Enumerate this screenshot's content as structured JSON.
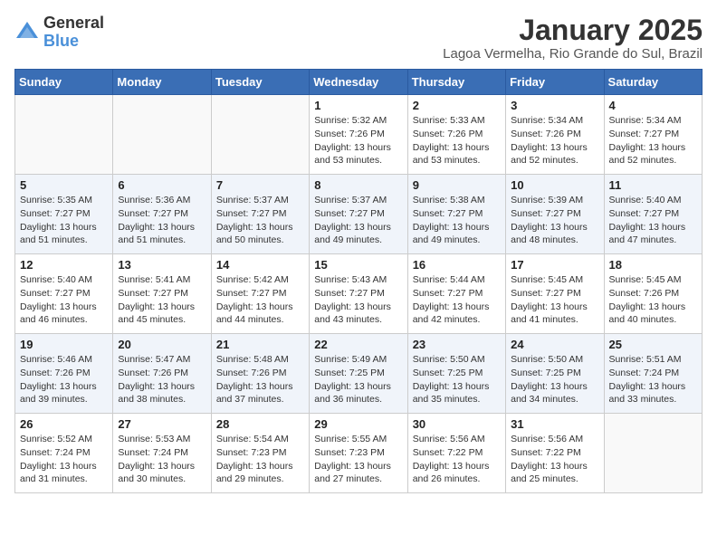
{
  "header": {
    "logo_general": "General",
    "logo_blue": "Blue",
    "month_title": "January 2025",
    "location": "Lagoa Vermelha, Rio Grande do Sul, Brazil"
  },
  "weekdays": [
    "Sunday",
    "Monday",
    "Tuesday",
    "Wednesday",
    "Thursday",
    "Friday",
    "Saturday"
  ],
  "weeks": [
    [
      {
        "day": "",
        "sunrise": "",
        "sunset": "",
        "daylight": ""
      },
      {
        "day": "",
        "sunrise": "",
        "sunset": "",
        "daylight": ""
      },
      {
        "day": "",
        "sunrise": "",
        "sunset": "",
        "daylight": ""
      },
      {
        "day": "1",
        "sunrise": "Sunrise: 5:32 AM",
        "sunset": "Sunset: 7:26 PM",
        "daylight": "Daylight: 13 hours and 53 minutes."
      },
      {
        "day": "2",
        "sunrise": "Sunrise: 5:33 AM",
        "sunset": "Sunset: 7:26 PM",
        "daylight": "Daylight: 13 hours and 53 minutes."
      },
      {
        "day": "3",
        "sunrise": "Sunrise: 5:34 AM",
        "sunset": "Sunset: 7:26 PM",
        "daylight": "Daylight: 13 hours and 52 minutes."
      },
      {
        "day": "4",
        "sunrise": "Sunrise: 5:34 AM",
        "sunset": "Sunset: 7:27 PM",
        "daylight": "Daylight: 13 hours and 52 minutes."
      }
    ],
    [
      {
        "day": "5",
        "sunrise": "Sunrise: 5:35 AM",
        "sunset": "Sunset: 7:27 PM",
        "daylight": "Daylight: 13 hours and 51 minutes."
      },
      {
        "day": "6",
        "sunrise": "Sunrise: 5:36 AM",
        "sunset": "Sunset: 7:27 PM",
        "daylight": "Daylight: 13 hours and 51 minutes."
      },
      {
        "day": "7",
        "sunrise": "Sunrise: 5:37 AM",
        "sunset": "Sunset: 7:27 PM",
        "daylight": "Daylight: 13 hours and 50 minutes."
      },
      {
        "day": "8",
        "sunrise": "Sunrise: 5:37 AM",
        "sunset": "Sunset: 7:27 PM",
        "daylight": "Daylight: 13 hours and 49 minutes."
      },
      {
        "day": "9",
        "sunrise": "Sunrise: 5:38 AM",
        "sunset": "Sunset: 7:27 PM",
        "daylight": "Daylight: 13 hours and 49 minutes."
      },
      {
        "day": "10",
        "sunrise": "Sunrise: 5:39 AM",
        "sunset": "Sunset: 7:27 PM",
        "daylight": "Daylight: 13 hours and 48 minutes."
      },
      {
        "day": "11",
        "sunrise": "Sunrise: 5:40 AM",
        "sunset": "Sunset: 7:27 PM",
        "daylight": "Daylight: 13 hours and 47 minutes."
      }
    ],
    [
      {
        "day": "12",
        "sunrise": "Sunrise: 5:40 AM",
        "sunset": "Sunset: 7:27 PM",
        "daylight": "Daylight: 13 hours and 46 minutes."
      },
      {
        "day": "13",
        "sunrise": "Sunrise: 5:41 AM",
        "sunset": "Sunset: 7:27 PM",
        "daylight": "Daylight: 13 hours and 45 minutes."
      },
      {
        "day": "14",
        "sunrise": "Sunrise: 5:42 AM",
        "sunset": "Sunset: 7:27 PM",
        "daylight": "Daylight: 13 hours and 44 minutes."
      },
      {
        "day": "15",
        "sunrise": "Sunrise: 5:43 AM",
        "sunset": "Sunset: 7:27 PM",
        "daylight": "Daylight: 13 hours and 43 minutes."
      },
      {
        "day": "16",
        "sunrise": "Sunrise: 5:44 AM",
        "sunset": "Sunset: 7:27 PM",
        "daylight": "Daylight: 13 hours and 42 minutes."
      },
      {
        "day": "17",
        "sunrise": "Sunrise: 5:45 AM",
        "sunset": "Sunset: 7:27 PM",
        "daylight": "Daylight: 13 hours and 41 minutes."
      },
      {
        "day": "18",
        "sunrise": "Sunrise: 5:45 AM",
        "sunset": "Sunset: 7:26 PM",
        "daylight": "Daylight: 13 hours and 40 minutes."
      }
    ],
    [
      {
        "day": "19",
        "sunrise": "Sunrise: 5:46 AM",
        "sunset": "Sunset: 7:26 PM",
        "daylight": "Daylight: 13 hours and 39 minutes."
      },
      {
        "day": "20",
        "sunrise": "Sunrise: 5:47 AM",
        "sunset": "Sunset: 7:26 PM",
        "daylight": "Daylight: 13 hours and 38 minutes."
      },
      {
        "day": "21",
        "sunrise": "Sunrise: 5:48 AM",
        "sunset": "Sunset: 7:26 PM",
        "daylight": "Daylight: 13 hours and 37 minutes."
      },
      {
        "day": "22",
        "sunrise": "Sunrise: 5:49 AM",
        "sunset": "Sunset: 7:25 PM",
        "daylight": "Daylight: 13 hours and 36 minutes."
      },
      {
        "day": "23",
        "sunrise": "Sunrise: 5:50 AM",
        "sunset": "Sunset: 7:25 PM",
        "daylight": "Daylight: 13 hours and 35 minutes."
      },
      {
        "day": "24",
        "sunrise": "Sunrise: 5:50 AM",
        "sunset": "Sunset: 7:25 PM",
        "daylight": "Daylight: 13 hours and 34 minutes."
      },
      {
        "day": "25",
        "sunrise": "Sunrise: 5:51 AM",
        "sunset": "Sunset: 7:24 PM",
        "daylight": "Daylight: 13 hours and 33 minutes."
      }
    ],
    [
      {
        "day": "26",
        "sunrise": "Sunrise: 5:52 AM",
        "sunset": "Sunset: 7:24 PM",
        "daylight": "Daylight: 13 hours and 31 minutes."
      },
      {
        "day": "27",
        "sunrise": "Sunrise: 5:53 AM",
        "sunset": "Sunset: 7:24 PM",
        "daylight": "Daylight: 13 hours and 30 minutes."
      },
      {
        "day": "28",
        "sunrise": "Sunrise: 5:54 AM",
        "sunset": "Sunset: 7:23 PM",
        "daylight": "Daylight: 13 hours and 29 minutes."
      },
      {
        "day": "29",
        "sunrise": "Sunrise: 5:55 AM",
        "sunset": "Sunset: 7:23 PM",
        "daylight": "Daylight: 13 hours and 27 minutes."
      },
      {
        "day": "30",
        "sunrise": "Sunrise: 5:56 AM",
        "sunset": "Sunset: 7:22 PM",
        "daylight": "Daylight: 13 hours and 26 minutes."
      },
      {
        "day": "31",
        "sunrise": "Sunrise: 5:56 AM",
        "sunset": "Sunset: 7:22 PM",
        "daylight": "Daylight: 13 hours and 25 minutes."
      },
      {
        "day": "",
        "sunrise": "",
        "sunset": "",
        "daylight": ""
      }
    ]
  ]
}
